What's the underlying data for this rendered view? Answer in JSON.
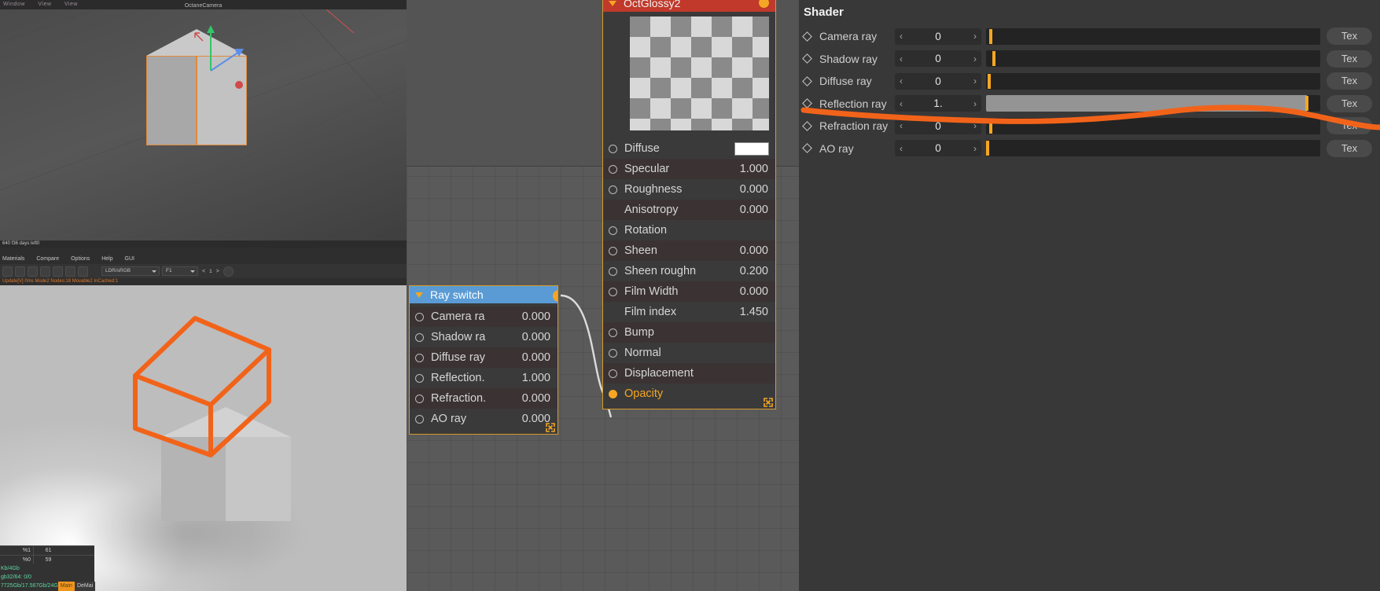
{
  "viewport": {
    "menu": [
      "Window",
      "View",
      "View"
    ],
    "camera_label": "OctaneCamera",
    "footer": "640 f36 days left0"
  },
  "material_editor": {
    "menu": [
      "Materials",
      "Compare",
      "Options",
      "Help",
      "GUI"
    ],
    "colorspace": "LDR/sRGB",
    "slot": "F1",
    "page": "1",
    "status": "Update[V] 0ms  Mode2  Nodes:18  Movable2  InCached:1"
  },
  "render_stats": {
    "row1": {
      "label": "%1",
      "value": "61"
    },
    "row2": {
      "label": "%0",
      "value": "59"
    },
    "mem": "Kb/4Gb",
    "gpu": "gb32/64: 0/0",
    "vram": "7725Gb/17.567Gb/24G",
    "tag_main": "Main",
    "tag_demain": "DeMai"
  },
  "nodes": {
    "ray_switch": {
      "title": "Ray switch",
      "rows": [
        {
          "label": "Camera ra",
          "value": "0.000",
          "pin": "open"
        },
        {
          "label": "Shadow ra",
          "value": "0.000",
          "pin": "open"
        },
        {
          "label": "Diffuse ray",
          "value": "0.000",
          "pin": "open"
        },
        {
          "label": "Reflection.",
          "value": "1.000",
          "pin": "open"
        },
        {
          "label": "Refraction.",
          "value": "0.000",
          "pin": "open"
        },
        {
          "label": "AO ray",
          "value": "0.000",
          "pin": "open"
        }
      ]
    },
    "glossy": {
      "title": "OctGlossy2",
      "rows": [
        {
          "label": "Diffuse",
          "value": "",
          "pin": "open",
          "swatch": "#ffffff"
        },
        {
          "label": "Specular",
          "value": "1.000",
          "pin": "open"
        },
        {
          "label": "Roughness",
          "value": "0.000",
          "pin": "open"
        },
        {
          "label": "Anisotropy",
          "value": "0.000",
          "pin": "none"
        },
        {
          "label": "Rotation",
          "value": "",
          "pin": "open"
        },
        {
          "label": "Sheen",
          "value": "0.000",
          "pin": "open"
        },
        {
          "label": "Sheen roughn",
          "value": "0.200",
          "pin": "open"
        },
        {
          "label": "Film Width",
          "value": "0.000",
          "pin": "open"
        },
        {
          "label": "Film index",
          "value": "1.450",
          "pin": "none"
        },
        {
          "label": "Bump",
          "value": "",
          "pin": "open"
        },
        {
          "label": "Normal",
          "value": "",
          "pin": "open"
        },
        {
          "label": "Displacement",
          "value": "",
          "pin": "open"
        },
        {
          "label": "Opacity",
          "value": "",
          "pin": "filled",
          "highlight": true
        }
      ]
    }
  },
  "shader_panel": {
    "title": "Shader",
    "tex_label": "Tex",
    "rows": [
      {
        "label": "Camera ray",
        "value": "0",
        "fill_pct": 0,
        "knob_pct": 1.5
      },
      {
        "label": "Shadow ray",
        "value": "0",
        "fill_pct": 0,
        "knob_pct": 2.3
      },
      {
        "label": "Diffuse ray",
        "value": "0",
        "fill_pct": 0,
        "knob_pct": 1.0
      },
      {
        "label": "Reflection ray",
        "value": "1.",
        "fill_pct": 96,
        "knob_pct": 96
      },
      {
        "label": "Refraction ray",
        "value": "0",
        "fill_pct": 0,
        "knob_pct": 1.5
      },
      {
        "label": "AO ray",
        "value": "0",
        "fill_pct": 0,
        "knob_pct": 0.5
      }
    ]
  },
  "annotation": {
    "color": "#f2631a",
    "shapes": [
      "cube-outline",
      "underline-reflection-ray"
    ]
  },
  "colors": {
    "accent_orange": "#f5a623",
    "node_title_blue": "#5a9bd5",
    "node_title_red": "#c0392b",
    "annotation_orange": "#f2631a"
  }
}
